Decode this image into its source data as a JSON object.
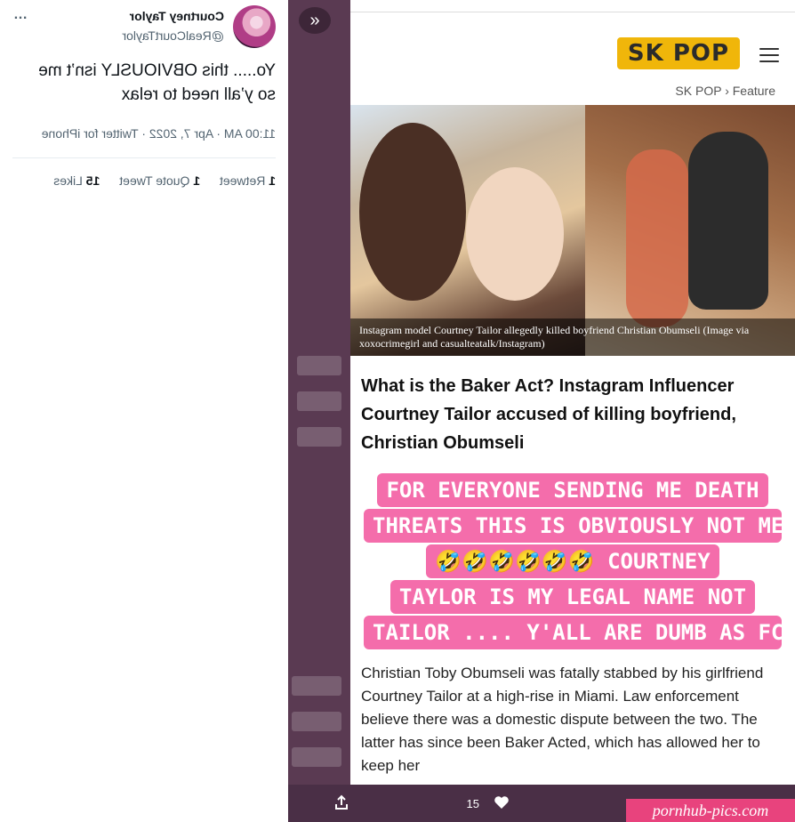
{
  "tweet": {
    "name": "Courtney Taylor",
    "handle": "@RealCourtTaylor",
    "more_icon": "…",
    "text": "Yo..... this OBVIOUSLY isn’t me so y’all need to relax",
    "meta": "11:00 AM · Apr 7, 2022 · Twitter for iPhone",
    "stats": {
      "retweets_count": "1",
      "retweets_label": "Retweet",
      "quotes_count": "1",
      "quotes_label": "Quote Tweet",
      "likes_count": "15",
      "likes_label": "Likes"
    }
  },
  "article": {
    "logo": "SK POP",
    "breadcrumb": "SK POP › Feature",
    "caption": "Instagram model Courtney Tailor allegedly killed boyfriend Christian Obumseli (Image via xoxocrimegirl and casualteatalk/Instagram)",
    "headline": "What is the Baker Act? Instagram Influencer Courtney Tailor accused of killing boyfriend, Christian Obumseli",
    "story_lines": [
      "FOR EVERYONE SENDING ME DEATH",
      "THREATS THIS IS OBVIOUSLY NOT ME",
      "🤣🤣🤣🤣🤣🤣 COURTNEY",
      "TAYLOR IS MY LEGAL NAME NOT",
      "TAILOR .... Y'ALL ARE DUMB AS FCK"
    ],
    "body": "Christian Toby Obumseli was fatally stabbed by his girlfriend Courtney Tailor at a high-rise in Miami. Law enforcement believe there was a domestic dispute between the two. The latter has since been Baker Acted, which has allowed her to keep her"
  },
  "bottom_bar": {
    "like_count": "15",
    "share_icon": "share-icon",
    "heart_icon": "heart-icon"
  },
  "watermark": "pornhub-pics.com",
  "colors": {
    "overlay": "#5a3a52",
    "pink": "#f46dab",
    "logo_yellow": "#f0b60a",
    "watermark": "#e8437d"
  }
}
